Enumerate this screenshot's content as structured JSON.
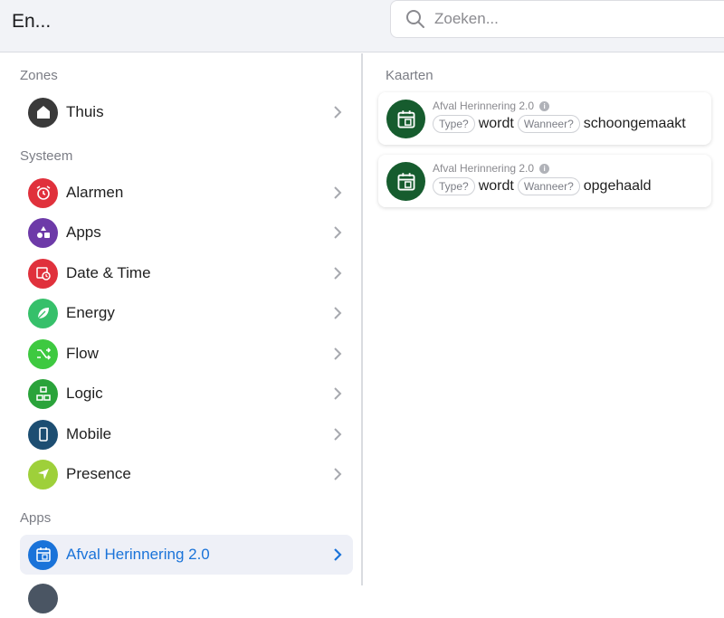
{
  "header": {
    "title": "En...",
    "search_placeholder": "Zoeken..."
  },
  "sidebar": {
    "sections": [
      {
        "label": "Zones"
      },
      {
        "label": "Systeem"
      },
      {
        "label": "Apps"
      }
    ],
    "zones": [
      {
        "label": "Thuis",
        "icon": "home-icon",
        "color": "#3a3a3a"
      }
    ],
    "system": [
      {
        "label": "Alarmen",
        "icon": "alarm-clock-icon",
        "color": "#e0313c"
      },
      {
        "label": "Apps",
        "icon": "shapes-icon",
        "color": "#6d3aa8"
      },
      {
        "label": "Date & Time",
        "icon": "calendar-clock-icon",
        "color": "#e0313c"
      },
      {
        "label": "Energy",
        "icon": "leaf-icon",
        "color": "#36c06a"
      },
      {
        "label": "Flow",
        "icon": "shuffle-icon",
        "color": "#3ec940"
      },
      {
        "label": "Logic",
        "icon": "logic-blocks-icon",
        "color": "#2aa33a"
      },
      {
        "label": "Mobile",
        "icon": "phone-icon",
        "color": "#1d4e72"
      },
      {
        "label": "Presence",
        "icon": "location-arrow-icon",
        "color": "#9ed03a"
      }
    ],
    "apps": [
      {
        "label": "Afval Herinnering 2.0",
        "icon": "calendar-trash-icon",
        "color": "#1a73d9",
        "active": true
      }
    ]
  },
  "main": {
    "section_label": "Kaarten",
    "cards": [
      {
        "app": "Afval Herinnering 2.0",
        "pill1": "Type?",
        "word1": "wordt",
        "pill2": "Wanneer?",
        "word2": "schoongemaakt"
      },
      {
        "app": "Afval Herinnering 2.0",
        "pill1": "Type?",
        "word1": "wordt",
        "pill2": "Wanneer?",
        "word2": "opgehaald"
      }
    ]
  }
}
